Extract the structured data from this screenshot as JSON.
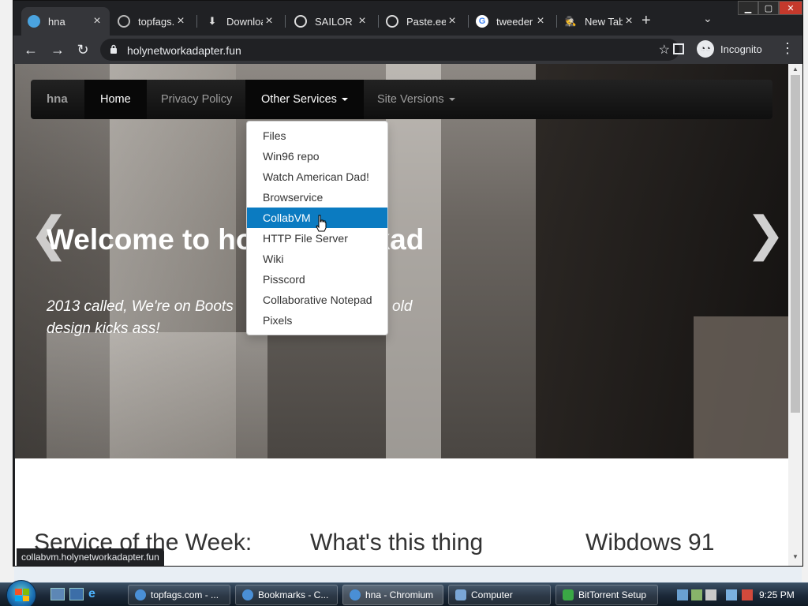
{
  "browser": {
    "tabs": [
      {
        "title": "hna",
        "icon": "globe-icon",
        "active": true
      },
      {
        "title": "topfags.",
        "icon": "globe-icon"
      },
      {
        "title": "Downloa",
        "icon": "download-icon"
      },
      {
        "title": "SAILOR N",
        "icon": "globe-icon"
      },
      {
        "title": "Paste.ee",
        "icon": "globe-icon"
      },
      {
        "title": "tweeder",
        "icon": "google-icon"
      },
      {
        "title": "New Tab",
        "icon": "incognito-icon"
      }
    ],
    "new_tab": "+",
    "url": "holynetworkadapter.fun",
    "profile_label": "Incognito",
    "status_url": "collabvm.holynetworkadapter.fun"
  },
  "site": {
    "brand": "hna",
    "nav": [
      {
        "label": "Home"
      },
      {
        "label": "Privacy Policy"
      },
      {
        "label": "Other Services"
      },
      {
        "label": "Site Versions"
      }
    ],
    "dropdown": [
      "Files",
      "Win96 repo",
      "Watch American Dad!",
      "Browservice",
      "CollabVM",
      "HTTP File Server",
      "Wiki",
      "Pisscord",
      "Collaborative Notepad",
      "Pixels"
    ],
    "dropdown_highlighted": "CollabVM",
    "hero_title": "Welcome to holynetworkad",
    "hero_subtitle": "2013 called, We're on Boots",
    "hero_subtitle_tail": "se old design kicks ass!",
    "carousel_prev": "❮",
    "carousel_next": "❯",
    "sections": [
      "Service of the Week:",
      "What's this thing",
      "Wibdows 91"
    ]
  },
  "taskbar": {
    "items": [
      {
        "label": "topfags.com - ..."
      },
      {
        "label": "Bookmarks - C..."
      },
      {
        "label": "hna - Chromium"
      },
      {
        "label": "Computer"
      },
      {
        "label": "BitTorrent Setup"
      }
    ],
    "clock": "9:25 PM"
  },
  "colors": {
    "dropdown_highlight": "#0b7bc1",
    "navbar": "#101010",
    "chrome_dark": "#202124"
  }
}
